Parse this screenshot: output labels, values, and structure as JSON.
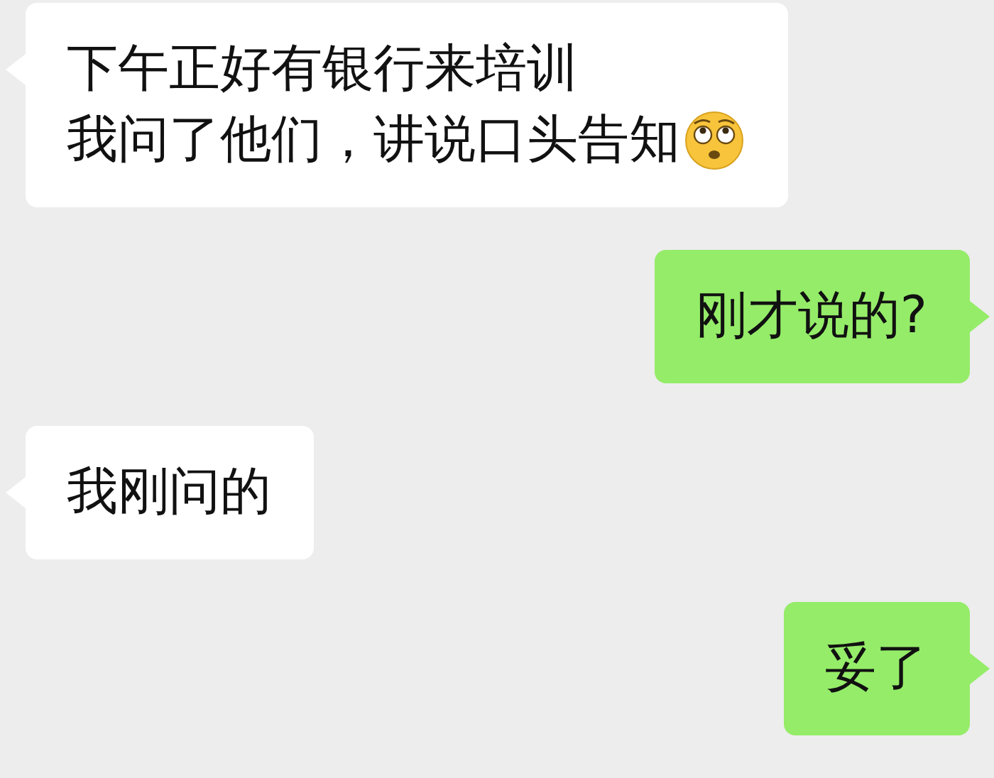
{
  "messages": [
    {
      "kind": "incoming",
      "lines": [
        "下午正好有银行来培训",
        "我问了他们，讲说口头告知"
      ],
      "emoji": true
    },
    {
      "kind": "outgoing",
      "lines": [
        "刚才说的?"
      ],
      "emoji": false
    },
    {
      "kind": "incoming",
      "lines": [
        "我刚问的"
      ],
      "emoji": false
    },
    {
      "kind": "outgoing",
      "lines": [
        "妥了"
      ],
      "emoji": false
    }
  ]
}
